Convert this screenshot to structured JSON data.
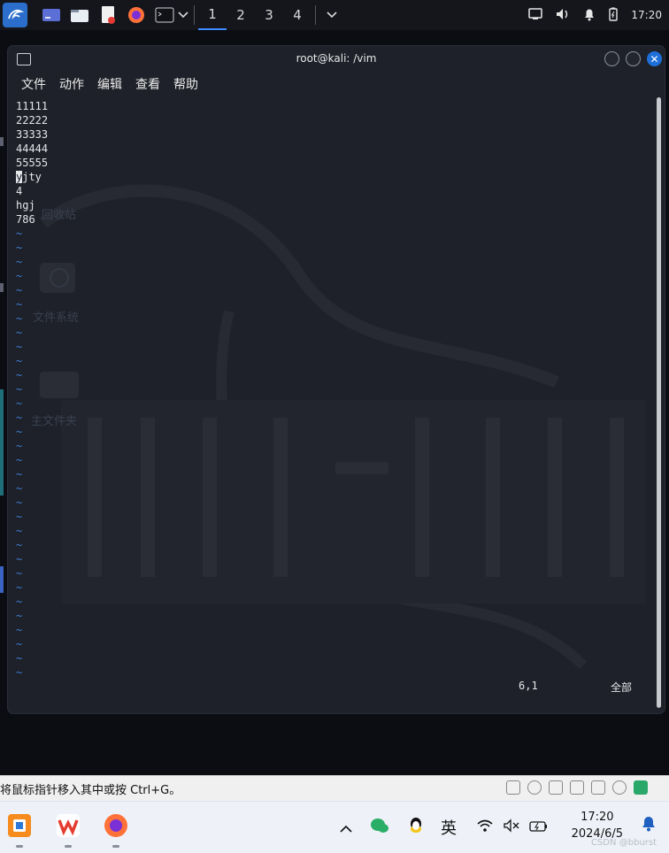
{
  "top_panel": {
    "workspaces": [
      "1",
      "2",
      "3",
      "4"
    ],
    "active_workspace": "1",
    "clock": "17:20",
    "icons": [
      "kali-menu-icon",
      "desktop-icon",
      "file-manager-icon",
      "text-editor-icon",
      "firefox-icon",
      "terminal-icon",
      "chevron-down-icon"
    ]
  },
  "terminal": {
    "title": "root@kali: /vim",
    "menu": [
      "文件",
      "动作",
      "编辑",
      "查看",
      "帮助"
    ],
    "lines": [
      "11111",
      "22222",
      "33333",
      "44444",
      "55555",
      "yjty",
      "4",
      "hgj",
      "786"
    ],
    "cursor_line": 6,
    "tilde_count": 32,
    "status_position": "6,1",
    "status_scope": "全部"
  },
  "desktop": {
    "labels": [
      "回收站",
      "文件系统",
      "主文件夹"
    ]
  },
  "vm_bar": {
    "message": "将鼠标指针移入其中或按 Ctrl+G。"
  },
  "taskbar": {
    "ime": "英",
    "time": "17:20",
    "date": "2024/6/5",
    "watermark": "CSDN @bburst"
  },
  "colors": {
    "accent": "#3d8bff",
    "tilde": "#3f7fd6",
    "terminal_bg": "#1e2129"
  }
}
